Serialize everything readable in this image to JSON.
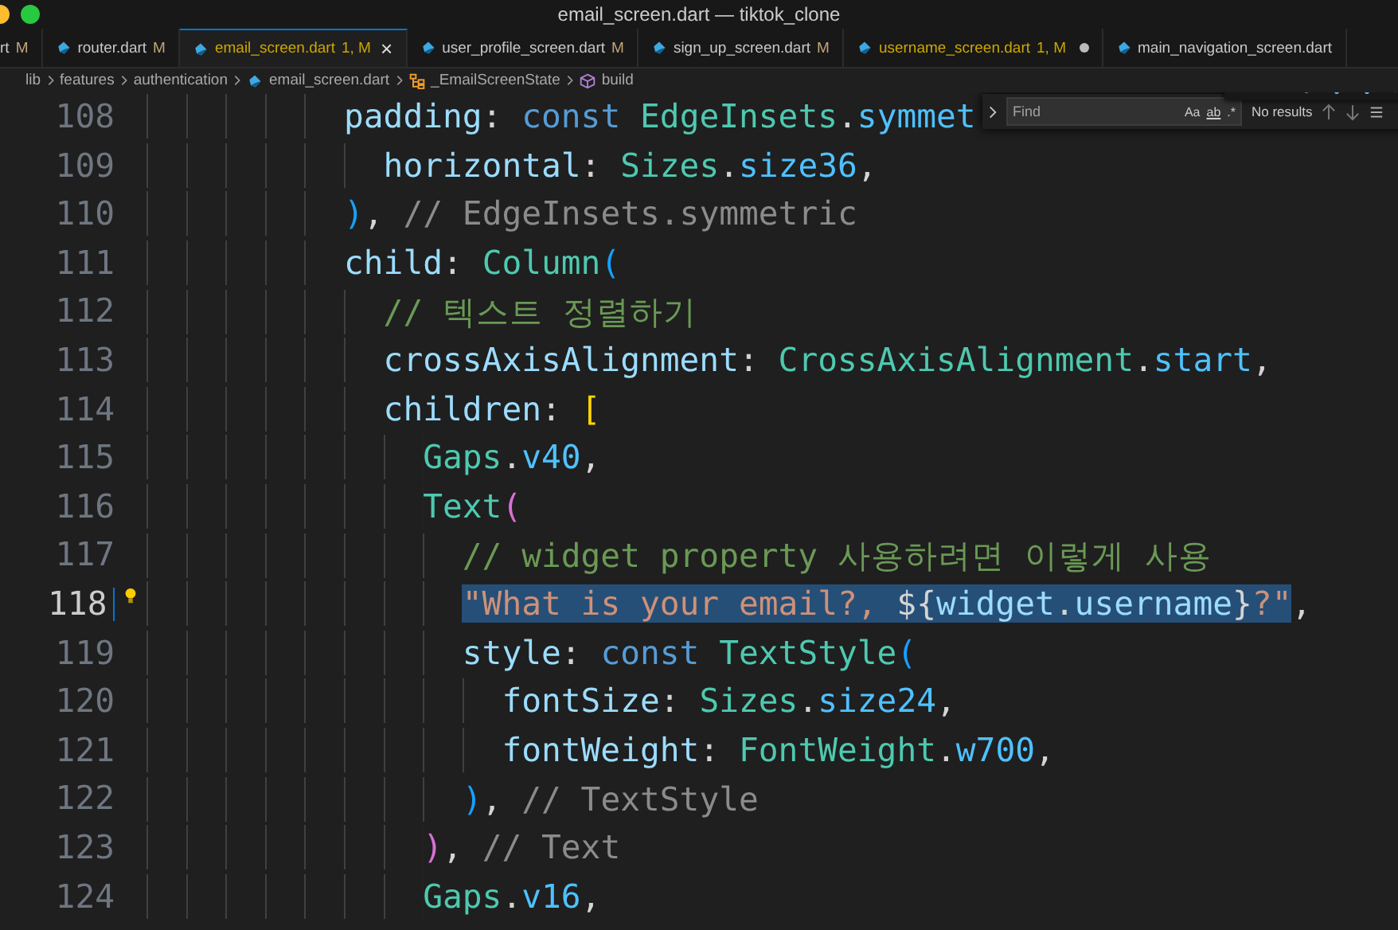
{
  "window": {
    "title": "email_screen.dart — tiktok_clone"
  },
  "tabs": [
    {
      "label": "rt",
      "status": "M",
      "selected": false,
      "problems": false,
      "dirty": false,
      "icon": false
    },
    {
      "label": "router.dart",
      "status": "M",
      "selected": false,
      "problems": false,
      "dirty": false,
      "icon": true
    },
    {
      "label": "email_screen.dart",
      "status": "1, M",
      "selected": true,
      "problems": true,
      "dirty": false,
      "icon": true
    },
    {
      "label": "user_profile_screen.dart",
      "status": "M",
      "selected": false,
      "problems": false,
      "dirty": false,
      "icon": true
    },
    {
      "label": "sign_up_screen.dart",
      "status": "M",
      "selected": false,
      "problems": false,
      "dirty": false,
      "icon": true
    },
    {
      "label": "username_screen.dart",
      "status": "1, M",
      "selected": false,
      "problems": true,
      "dirty": true,
      "icon": true
    },
    {
      "label": "main_navigation_screen.dart",
      "selected": false,
      "problems": false,
      "dirty": false,
      "icon": true
    }
  ],
  "close_glyph": "×",
  "breadcrumb": [
    {
      "kind": "folder",
      "label": "lib"
    },
    {
      "kind": "folder",
      "label": "features"
    },
    {
      "kind": "folder",
      "label": "authentication"
    },
    {
      "kind": "file",
      "label": "email_screen.dart"
    },
    {
      "kind": "class",
      "label": "_EmailScreenState"
    },
    {
      "kind": "method",
      "label": "build"
    }
  ],
  "find_widget": {
    "placeholder": "Find",
    "options": [
      "Aa",
      "ab",
      ".*"
    ],
    "result": "No results"
  },
  "editor": {
    "lines": [
      {
        "number": "108",
        "current": false,
        "lightbulb": false,
        "parts": [
          {
            "text": "          padding: const EdgeInsets.symmet",
            "selected": false
          }
        ]
      },
      {
        "number": "109",
        "current": false,
        "lightbulb": false,
        "parts": [
          {
            "text": "            horizontal: Sizes.size36,",
            "selected": false
          }
        ]
      },
      {
        "number": "110",
        "current": false,
        "lightbulb": false,
        "parts": [
          {
            "text": "          ), // EdgeInsets.symmetric",
            "selected": false
          }
        ]
      },
      {
        "number": "111",
        "current": false,
        "lightbulb": false,
        "parts": [
          {
            "text": "          child: Column(",
            "selected": false
          }
        ]
      },
      {
        "number": "112",
        "current": false,
        "lightbulb": false,
        "parts": [
          {
            "text": "            // 텍스트 정렬하기",
            "selected": false
          }
        ]
      },
      {
        "number": "113",
        "current": false,
        "lightbulb": false,
        "parts": [
          {
            "text": "            crossAxisAlignment: CrossAxisAlignment.start,",
            "selected": false
          }
        ]
      },
      {
        "number": "114",
        "current": false,
        "lightbulb": false,
        "parts": [
          {
            "text": "            children: [",
            "selected": false
          }
        ]
      },
      {
        "number": "115",
        "current": false,
        "lightbulb": false,
        "parts": [
          {
            "text": "              Gaps.v40,",
            "selected": false
          }
        ]
      },
      {
        "number": "116",
        "current": false,
        "lightbulb": false,
        "parts": [
          {
            "text": "              Text(",
            "selected": false
          }
        ]
      },
      {
        "number": "117",
        "current": false,
        "lightbulb": false,
        "parts": [
          {
            "text": "                // widget property 사용하려면 이렇게 사용",
            "selected": false
          }
        ]
      },
      {
        "number": "118",
        "current": true,
        "lightbulb": true,
        "parts": [
          {
            "text": "                \"What is your email?, ${widget.username}?\"",
            "selected": true
          },
          {
            "text": ",",
            "selected": false
          }
        ]
      },
      {
        "number": "119",
        "current": false,
        "lightbulb": false,
        "parts": [
          {
            "text": "                style: const TextStyle(",
            "selected": false
          }
        ]
      },
      {
        "number": "120",
        "current": false,
        "lightbulb": false,
        "parts": [
          {
            "text": "                  fontSize: Sizes.size24,",
            "selected": false
          }
        ]
      },
      {
        "number": "121",
        "current": false,
        "lightbulb": false,
        "parts": [
          {
            "text": "                  fontWeight: FontWeight.w700,",
            "selected": false
          }
        ]
      },
      {
        "number": "122",
        "current": false,
        "lightbulb": false,
        "parts": [
          {
            "text": "                ), // TextStyle",
            "selected": false
          }
        ]
      },
      {
        "number": "123",
        "current": false,
        "lightbulb": false,
        "parts": [
          {
            "text": "              ), // Text",
            "selected": false
          }
        ]
      },
      {
        "number": "124",
        "current": false,
        "lightbulb": false,
        "parts": [
          {
            "text": "              Gaps.v16,",
            "selected": false
          }
        ]
      }
    ]
  }
}
